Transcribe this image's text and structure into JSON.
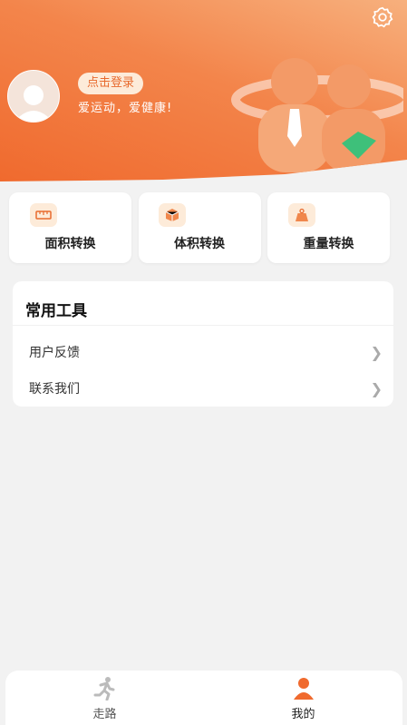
{
  "header": {
    "login_button": "点击登录",
    "slogan": "爱运动，爱健康!",
    "settings_icon": "gear-icon",
    "accent": "#f06a2e"
  },
  "conversion_cards": [
    {
      "label": "面积转换",
      "icon": "ruler-icon"
    },
    {
      "label": "体积转换",
      "icon": "box-icon"
    },
    {
      "label": "重量转换",
      "icon": "weight-icon"
    }
  ],
  "tools": {
    "title": "常用工具",
    "items": [
      {
        "label": "用户反馈"
      },
      {
        "label": "联系我们"
      }
    ]
  },
  "tabbar": {
    "tabs": [
      {
        "label": "走路",
        "icon": "running-person-icon",
        "active": false
      },
      {
        "label": "我的",
        "icon": "user-icon",
        "active": true
      }
    ]
  }
}
